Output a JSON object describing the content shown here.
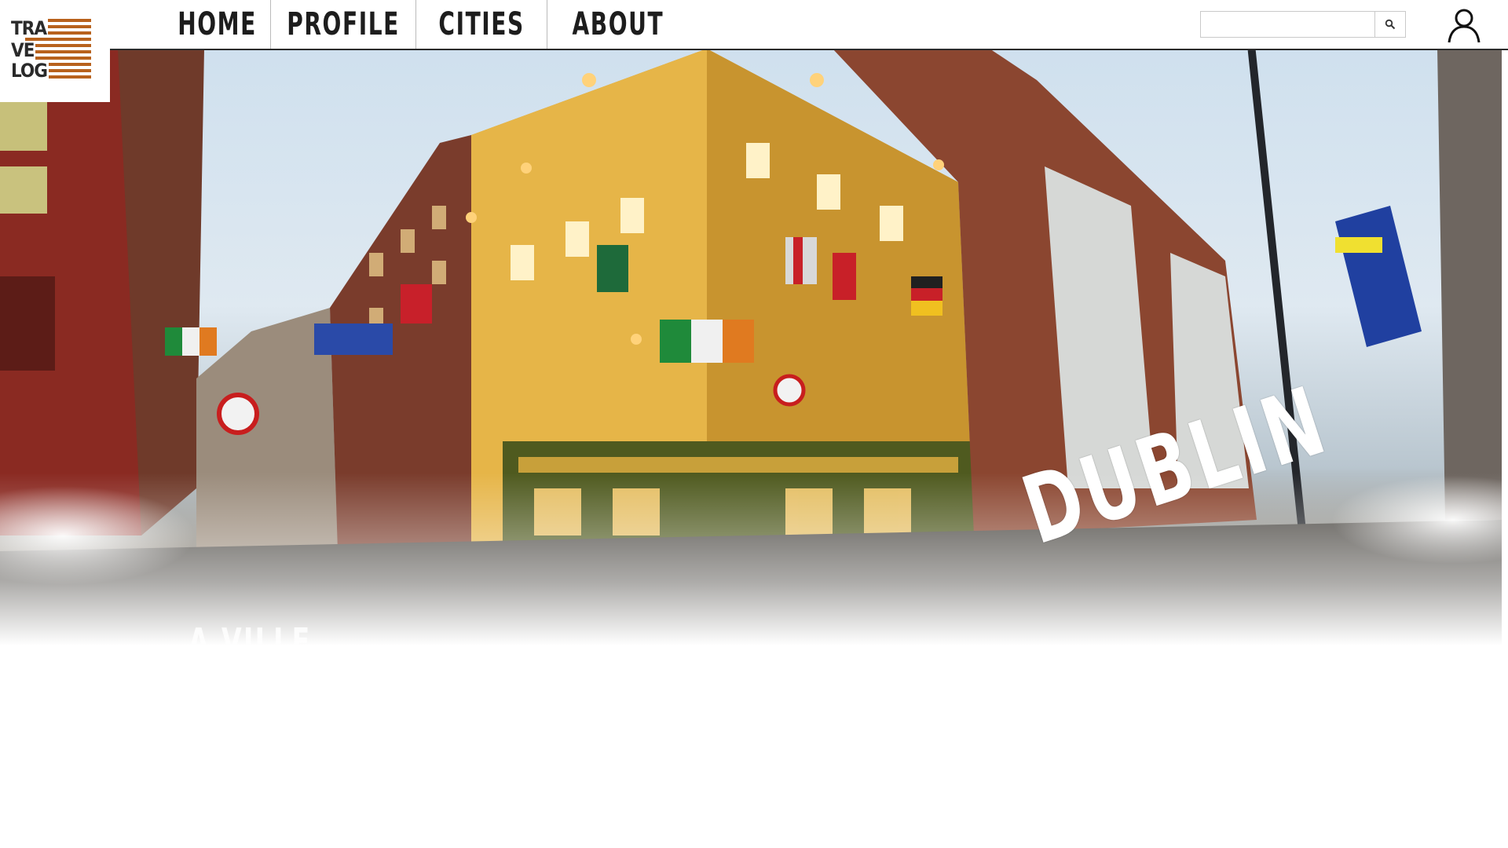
{
  "logo": {
    "line1": "TRA",
    "line2": "VE",
    "line3": "LOG"
  },
  "nav": {
    "items": [
      {
        "label": "HOME"
      },
      {
        "label": "PROFILE"
      },
      {
        "label": "CITIES"
      },
      {
        "label": "ABOUT"
      }
    ]
  },
  "search": {
    "value": "",
    "placeholder": "",
    "icon": "search-icon"
  },
  "user": {
    "icon": "user-icon"
  },
  "hero": {
    "city": "DUBLIN",
    "subtitle": "A VILLE"
  },
  "colors": {
    "accent": "#b8621d",
    "nav_text": "#1d1d1d",
    "border": "#2b2b2b"
  }
}
